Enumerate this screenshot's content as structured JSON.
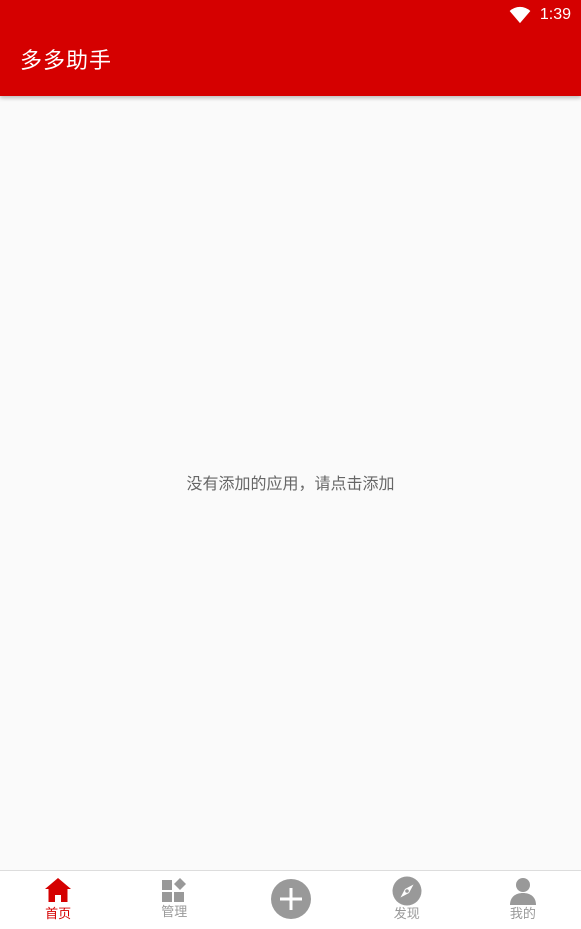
{
  "status_bar": {
    "time": "1:39",
    "wifi_icon": "wifi-icon"
  },
  "app_bar": {
    "title": "多多助手"
  },
  "main": {
    "empty_message": "没有添加的应用，请点击添加"
  },
  "bottom_nav": {
    "items": [
      {
        "label": "首页",
        "icon": "home-icon",
        "active": true
      },
      {
        "label": "管理",
        "icon": "apps-icon",
        "active": false
      },
      {
        "label": "",
        "icon": "add-circle-icon",
        "active": false
      },
      {
        "label": "发现",
        "icon": "compass-icon",
        "active": false
      },
      {
        "label": "我的",
        "icon": "person-icon",
        "active": false
      }
    ]
  },
  "colors": {
    "primary": "#d50000",
    "background": "#fafafa",
    "inactive": "#999999",
    "text_muted": "#666666"
  }
}
